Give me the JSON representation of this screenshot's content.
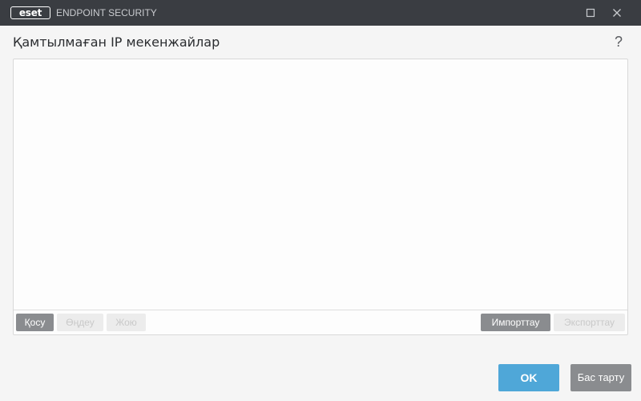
{
  "titlebar": {
    "logo_text": "eset",
    "app_name": "ENDPOINT SECURITY",
    "maximize_icon": "maximize-icon",
    "close_icon": "close-icon"
  },
  "dialog": {
    "title": "Қамтылмаған IP мекенжайлар",
    "help_label": "?"
  },
  "list": {
    "rows": []
  },
  "toolbar": {
    "add_label": "Қосу",
    "edit_label": "Өңдеу",
    "delete_label": "Жою",
    "import_label": "Импорттау",
    "export_label": "Экспорттау"
  },
  "footer": {
    "ok_label": "OK",
    "cancel_label": "Бас тарту"
  },
  "colors": {
    "titlebar_bg": "#3a3d42",
    "primary_button": "#4fa7d8",
    "secondary_button": "#8a8c8f",
    "disabled_button": "#ececec"
  }
}
